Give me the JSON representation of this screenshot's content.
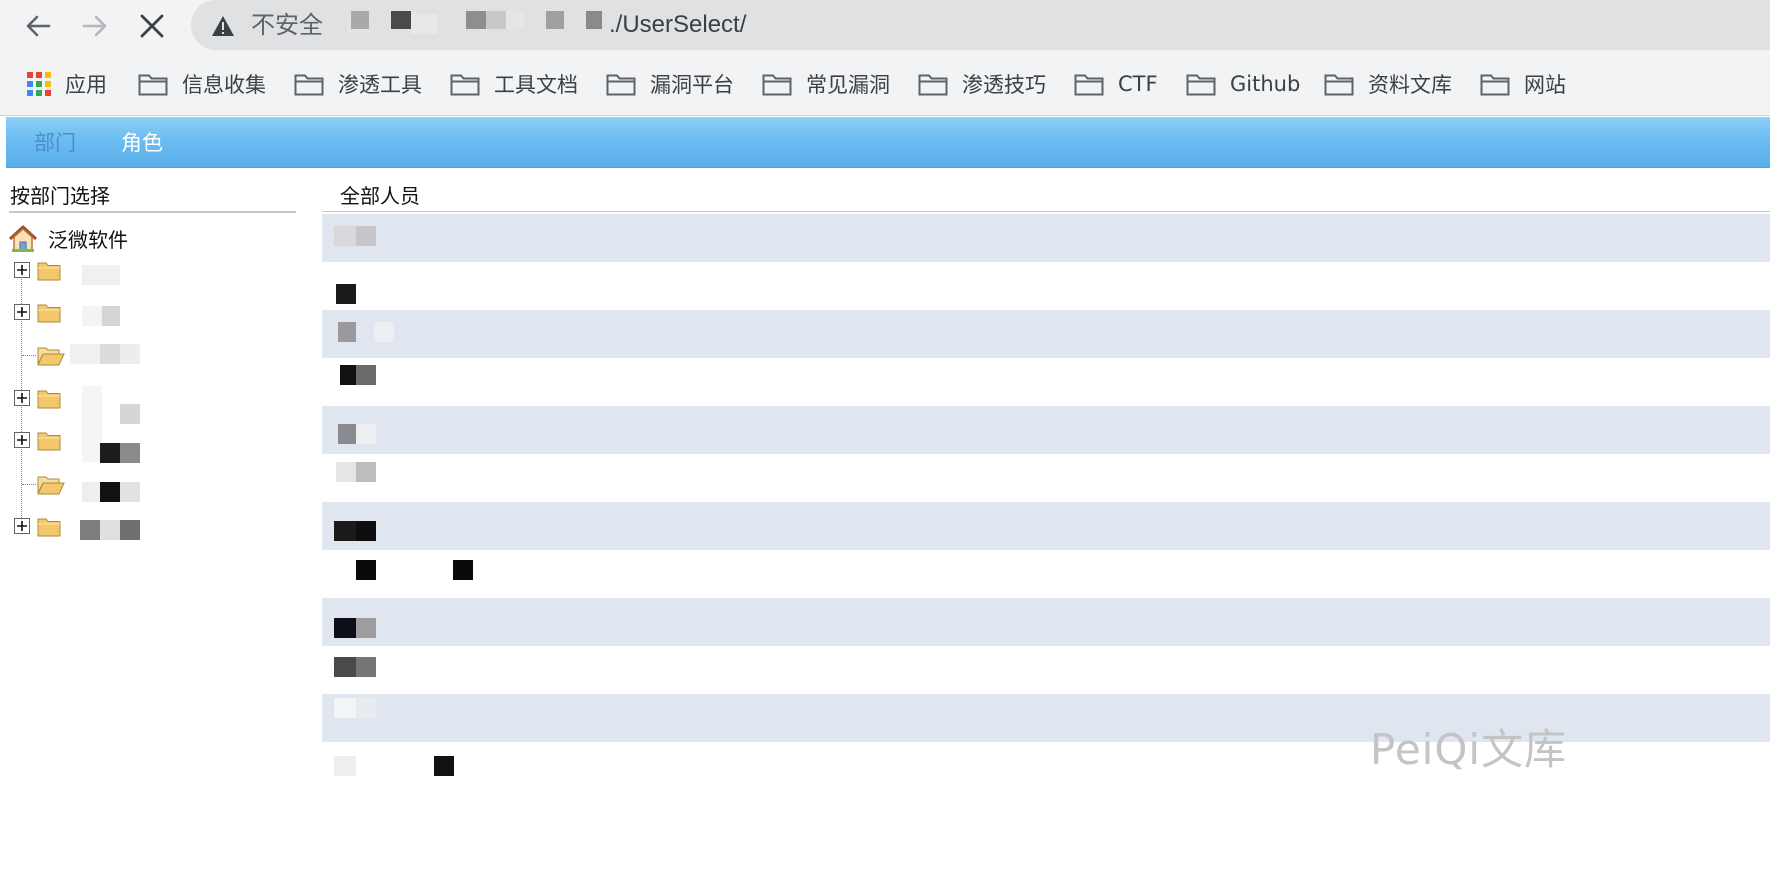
{
  "browser": {
    "security_label": "不安全",
    "url_visible": "./UserSelect/"
  },
  "bookmarks": {
    "apps_label": "应用",
    "items": [
      {
        "label": "信息收集"
      },
      {
        "label": "渗透工具"
      },
      {
        "label": "工具文档"
      },
      {
        "label": "漏洞平台"
      },
      {
        "label": "常见漏洞"
      },
      {
        "label": "渗透技巧"
      },
      {
        "label": "CTF"
      },
      {
        "label": "Github"
      },
      {
        "label": "资料文库"
      },
      {
        "label": "网站"
      }
    ]
  },
  "tabs": [
    {
      "label": "部门"
    },
    {
      "label": "角色"
    }
  ],
  "left_panel": {
    "title": "按部门选择",
    "root_label": "泛微软件"
  },
  "right_panel": {
    "title": "全部人员"
  },
  "watermark": "PeiQi文库",
  "colors": {
    "tab_bar": "#6bbcf0",
    "row_alt": "#e0e6ef",
    "folder": "#f3c76b"
  }
}
